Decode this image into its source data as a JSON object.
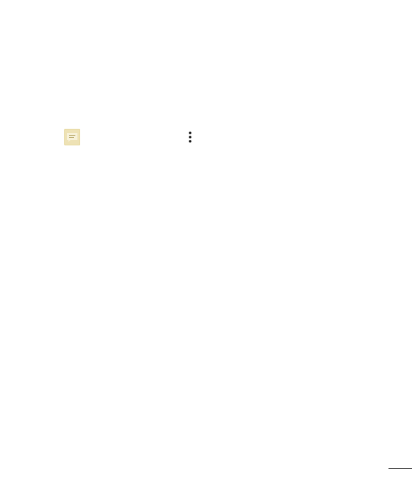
{
  "icons": {
    "message": "message-app-icon",
    "overflow": "vertical-dots-menu-icon"
  },
  "colors": {
    "message_icon_bg": "#e6d79c",
    "message_icon_bubble": "#f7f1d9",
    "message_icon_lines": "#b8a96a",
    "overflow_dots": "#111111",
    "page_rule": "#222222"
  }
}
